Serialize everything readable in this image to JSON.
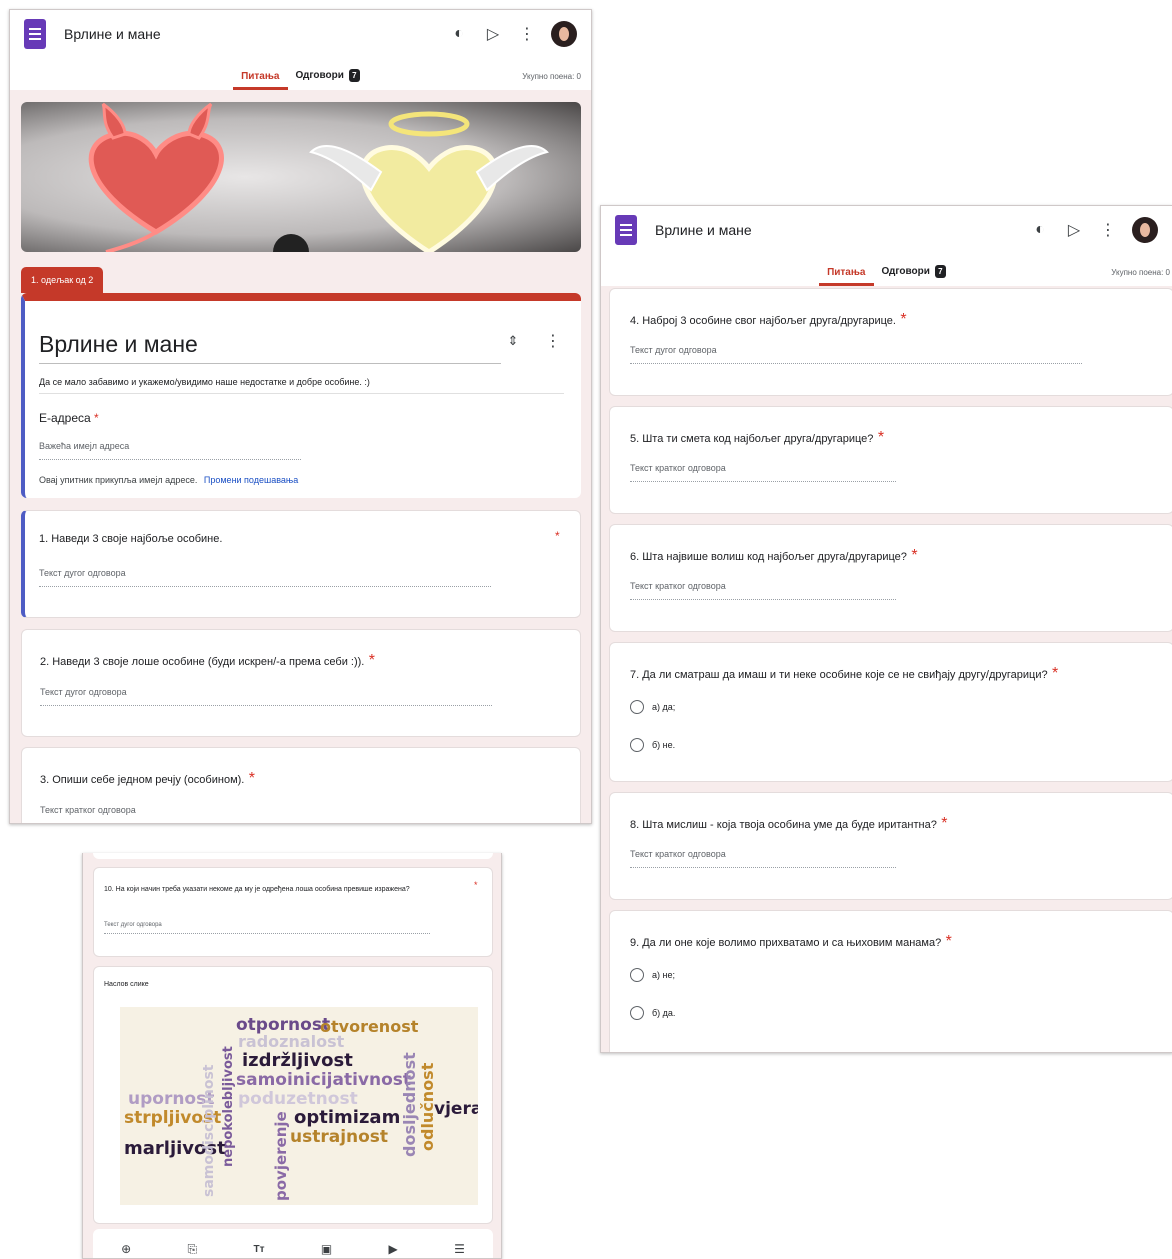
{
  "app": {
    "title": "Врлине и мане",
    "tabs": {
      "questions": "Питања",
      "responses": "Одговори",
      "responses_count": "7"
    },
    "points": "Укупно поена: 0"
  },
  "section": {
    "tag": "1. одељак од 2",
    "title": "Врлине и мане",
    "description": "Да се мало забавимо и укажемо/увидимо наше недостатке и добре особине. :)",
    "email_label": "Е-адреса",
    "email_placeholder": "Важећа имејл адреса",
    "email_note": "Овај упитник прикупља имејл адресе.",
    "email_link": "Промени подешавања"
  },
  "questions": [
    {
      "title": "1. Наведи 3 своје најбоље особине.",
      "hint": "Текст дугог одговора"
    },
    {
      "title": "2. Наведи 3 своје лоше особине (буди искрен/-а према себи :)).",
      "hint": "Текст дугог одговора"
    },
    {
      "title": "3. Опиши себе једном речју (особином).",
      "hint": "Текст кратког одговора"
    },
    {
      "title": "4. Наброј 3 особине свог најбољег друга/другарице.",
      "hint": "Текст дугог одговора"
    },
    {
      "title": "5. Шта ти смета код најбољег друга/другарице?",
      "hint": "Текст кратког одговора"
    },
    {
      "title": "6. Шта највише волиш код најбољег друга/другарице?",
      "hint": "Текст кратког одговора"
    },
    {
      "title": "7. Да ли сматраш да имаш и ти неке особине које се не свиђају другу/другарици?",
      "options": [
        "а) да;",
        "б) не."
      ]
    },
    {
      "title": "8. Шта мислиш - која твоја особина уме да буде иритантна?",
      "hint": "Текст кратког одговора"
    },
    {
      "title": "9. Да ли оне које волимо прихватамо и са њиховим манама?",
      "options": [
        "а) не;",
        "б) да."
      ]
    },
    {
      "title": "10. На који начин треба указати некоме да му је одређена лоша особина превише изражена?",
      "hint": "Текст дугог одговора"
    }
  ],
  "image_card": {
    "title": "Наслов слике",
    "words": [
      {
        "text": "otpornost",
        "color": "#6a4a8a"
      },
      {
        "text": "otvorenost",
        "color": "#b5832b"
      },
      {
        "text": "radoznalost",
        "color": "#c9c2d4"
      },
      {
        "text": "izdržljivost",
        "color": "#2b1b3a"
      },
      {
        "text": "samoinicijativnost",
        "color": "#8a6aa6"
      },
      {
        "text": "poduzetnost",
        "color": "#d0c7da"
      },
      {
        "text": "upornost",
        "color": "#b09cc4"
      },
      {
        "text": "strpljivost",
        "color": "#c18a2c"
      },
      {
        "text": "optimizam",
        "color": "#2b1b3a"
      },
      {
        "text": "ustrajnost",
        "color": "#b5832b"
      },
      {
        "text": "marljivost",
        "color": "#2b1b3a"
      },
      {
        "text": "vjera",
        "color": "#2b1b3a"
      },
      {
        "text": "samodisciplinost",
        "color": "#c9c2d4"
      },
      {
        "text": "nepokolebljivost",
        "color": "#7a5a9a"
      },
      {
        "text": "povjerenje",
        "color": "#8a6aa6"
      },
      {
        "text": "dosljednost",
        "color": "#9a86b4"
      },
      {
        "text": "odlučnost",
        "color": "#c18a2c"
      }
    ]
  },
  "colors": {
    "accent": "#c53929",
    "purple": "#673ab7",
    "focus": "#4e5cc4"
  },
  "icons": [
    "palette-icon",
    "send-icon",
    "more-vert-icon",
    "add-question-icon",
    "import-icon",
    "title-icon",
    "image-icon",
    "video-icon",
    "section-icon"
  ]
}
